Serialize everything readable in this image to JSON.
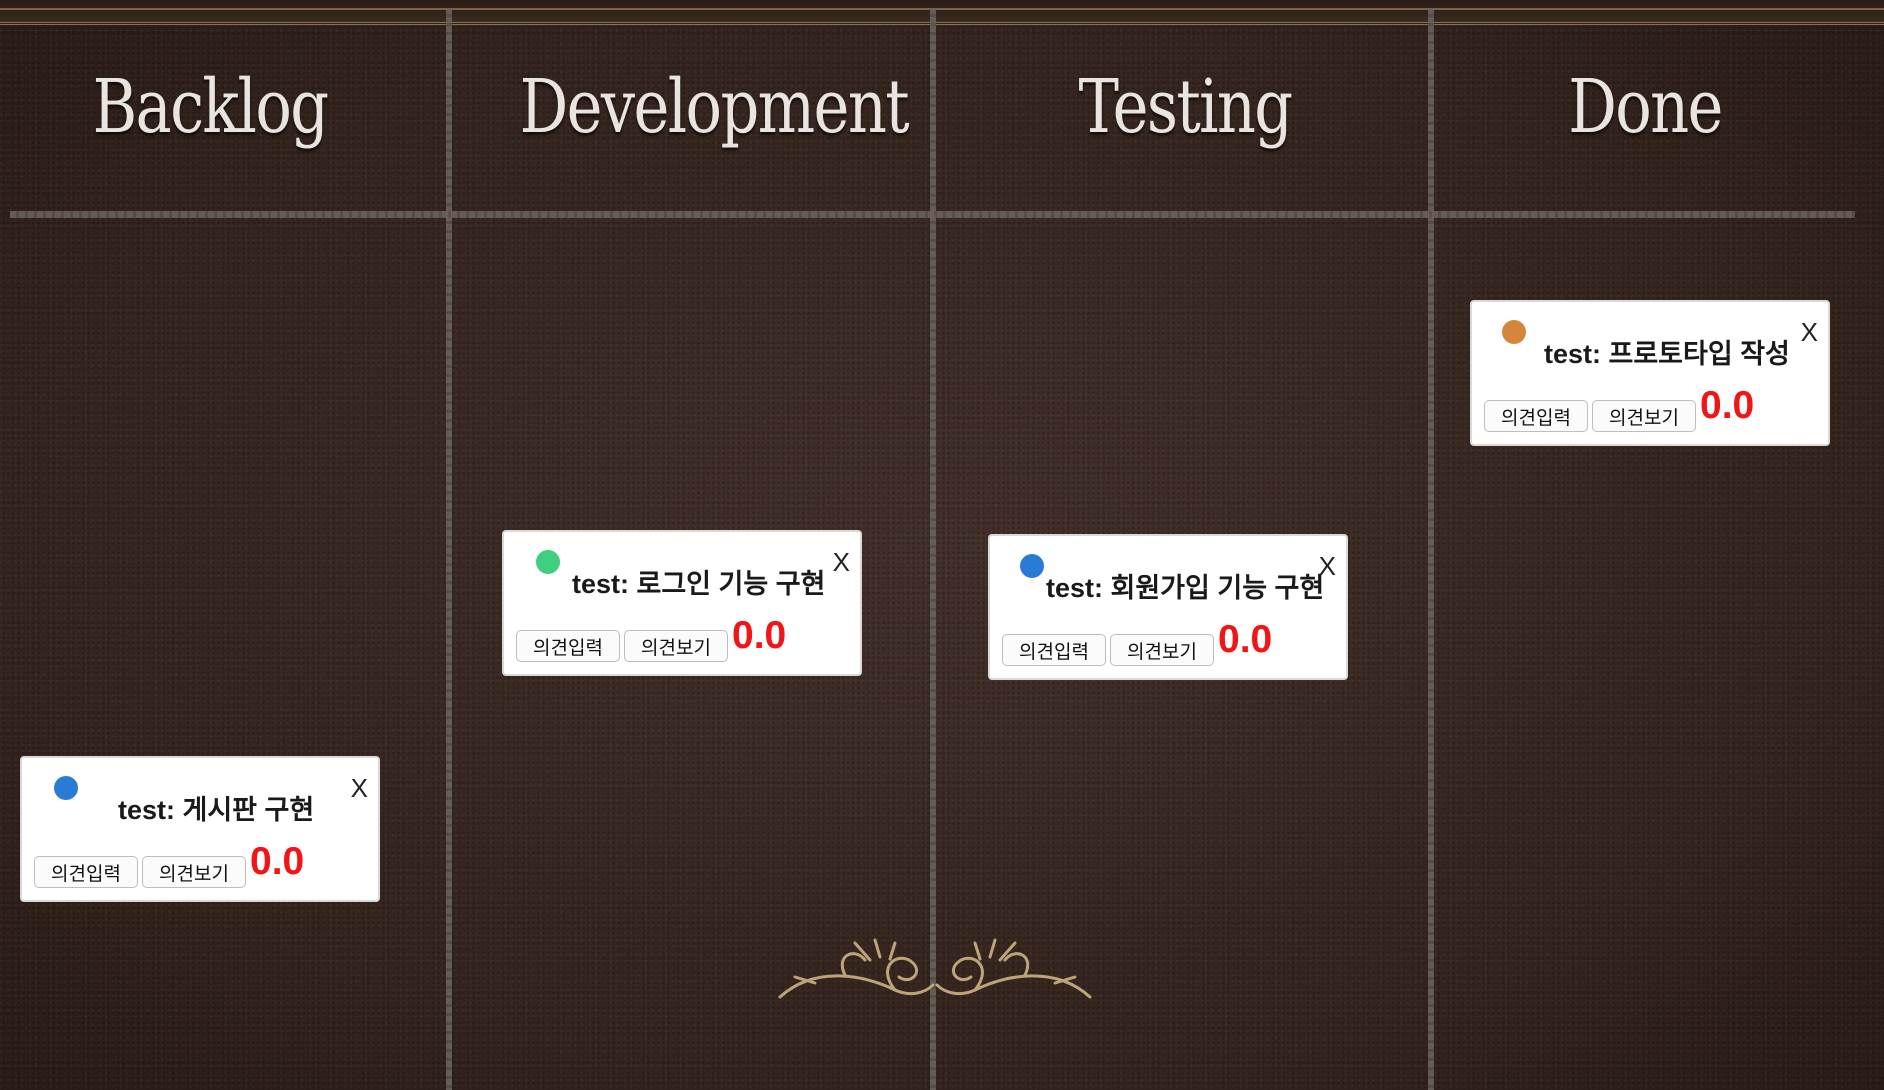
{
  "board": {
    "columns": [
      {
        "title": "Backlog"
      },
      {
        "title": "Development"
      },
      {
        "title": "Testing"
      },
      {
        "title": "Done"
      }
    ]
  },
  "cards": [
    {
      "title": "test: 게시판 구현",
      "dot_color": "#2a7bd6",
      "btn_input": "의견입력",
      "btn_view": "의견보기",
      "score": "0.0",
      "close": "X"
    },
    {
      "title": "test: 로그인 기능 구현",
      "dot_color": "#3fcf7f",
      "btn_input": "의견입력",
      "btn_view": "의견보기",
      "score": "0.0",
      "close": "X"
    },
    {
      "title": "test: 회원가입 기능 구현",
      "dot_color": "#2a7bd6",
      "btn_input": "의견입력",
      "btn_view": "의견보기",
      "score": "0.0",
      "close": "X"
    },
    {
      "title": "test: 프로토타입 작성",
      "dot_color": "#d4873a",
      "btn_input": "의견입력",
      "btn_view": "의견보기",
      "score": "0.0",
      "close": "X"
    }
  ],
  "colors": {
    "background": "#3a2820",
    "score": "#f21417",
    "ornament": "#bda47a"
  }
}
